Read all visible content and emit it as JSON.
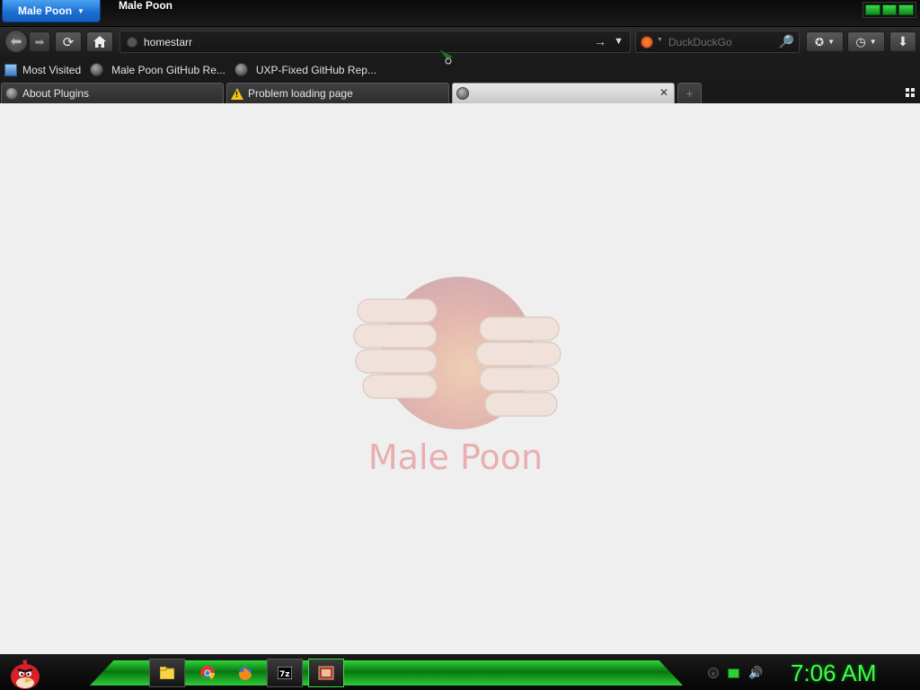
{
  "window": {
    "app_menu_label": "Male Poon",
    "title": "Male Poon"
  },
  "nav": {
    "back_icon": "back-arrow-icon",
    "forward_icon": "forward-arrow-icon",
    "reload_icon": "reload-icon",
    "home_icon": "home-icon",
    "url_value": "homestarr",
    "search_placeholder": "DuckDuckGo",
    "search_engine_icon": "duckduckgo-icon"
  },
  "bookmarks": {
    "items": [
      {
        "label": "Most Visited",
        "icon": "most-visited-icon"
      },
      {
        "label": "Male Poon GitHub Re...",
        "icon": "globe-icon"
      },
      {
        "label": "UXP-Fixed GitHub Rep...",
        "icon": "globe-icon"
      }
    ]
  },
  "tabs": [
    {
      "label": "About Plugins",
      "icon": "globe-icon"
    },
    {
      "label": "Problem loading page",
      "icon": "warning-icon"
    },
    {
      "label": "",
      "icon": "globe-icon",
      "active": true
    }
  ],
  "content": {
    "logo_text": "Male Poon"
  },
  "taskbar": {
    "clock": "7:06 AM",
    "apps": [
      "explorer-icon",
      "chrome-icon",
      "firefox-icon",
      "7zip-icon",
      "browser-icon"
    ],
    "accent": "#3cff4a"
  }
}
